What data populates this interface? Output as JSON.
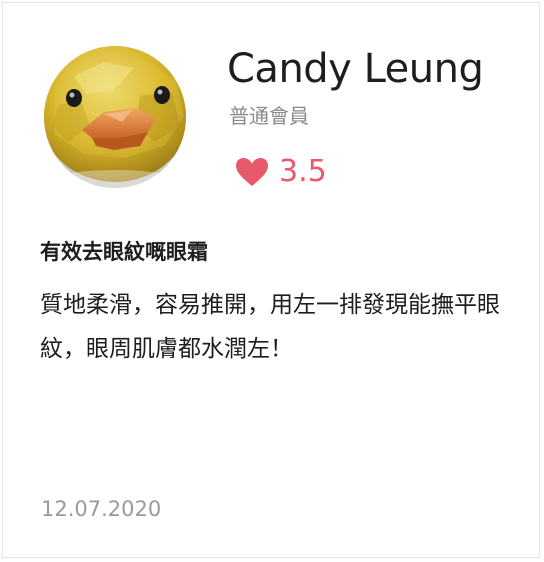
{
  "review": {
    "user_name": "Candy Leung",
    "member_level": "普通會員",
    "rating": "3.5",
    "title": "有效去眼紋嘅眼霜",
    "body": "質地柔滑，容易推開，用左一排發現能撫平眼紋，眼周肌膚都水潤左！",
    "date": "12.07.2020"
  },
  "colors": {
    "accent": "#e8596c",
    "muted_text": "#8a8a8a",
    "date_text": "#9a9a9a"
  },
  "icons": {
    "avatar": "yellow-duck-avatar",
    "rating": "heart-icon"
  }
}
